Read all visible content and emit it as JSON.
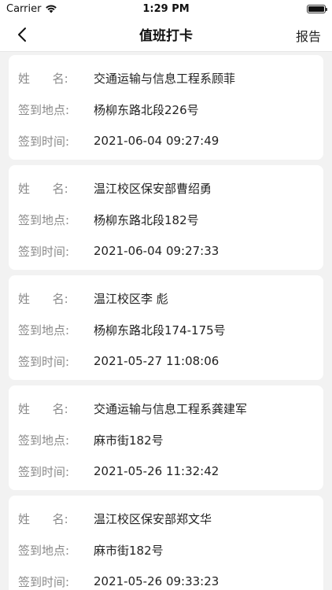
{
  "status": {
    "carrier": "Carrier",
    "time": "1:29 PM"
  },
  "nav": {
    "title": "值班打卡",
    "report": "报告"
  },
  "labels": {
    "name": "姓      名:",
    "location": "签到地点:",
    "time": "签到时间:"
  },
  "records": [
    {
      "name": "交通运输与信息工程系顾菲",
      "location": "杨柳东路北段226号",
      "time": "2021-06-04 09:27:49"
    },
    {
      "name": "温江校区保安部曹绍勇",
      "location": "杨柳东路北段182号",
      "time": "2021-06-04 09:27:33"
    },
    {
      "name": "温江校区李 彪",
      "location": "杨柳东路北段174-175号",
      "time": "2021-05-27 11:08:06"
    },
    {
      "name": "交通运输与信息工程系龚建军",
      "location": "麻市街182号",
      "time": "2021-05-26 11:32:42"
    },
    {
      "name": "温江校区保安部郑文华",
      "location": "麻市街182号",
      "time": "2021-05-26 09:33:23"
    }
  ]
}
